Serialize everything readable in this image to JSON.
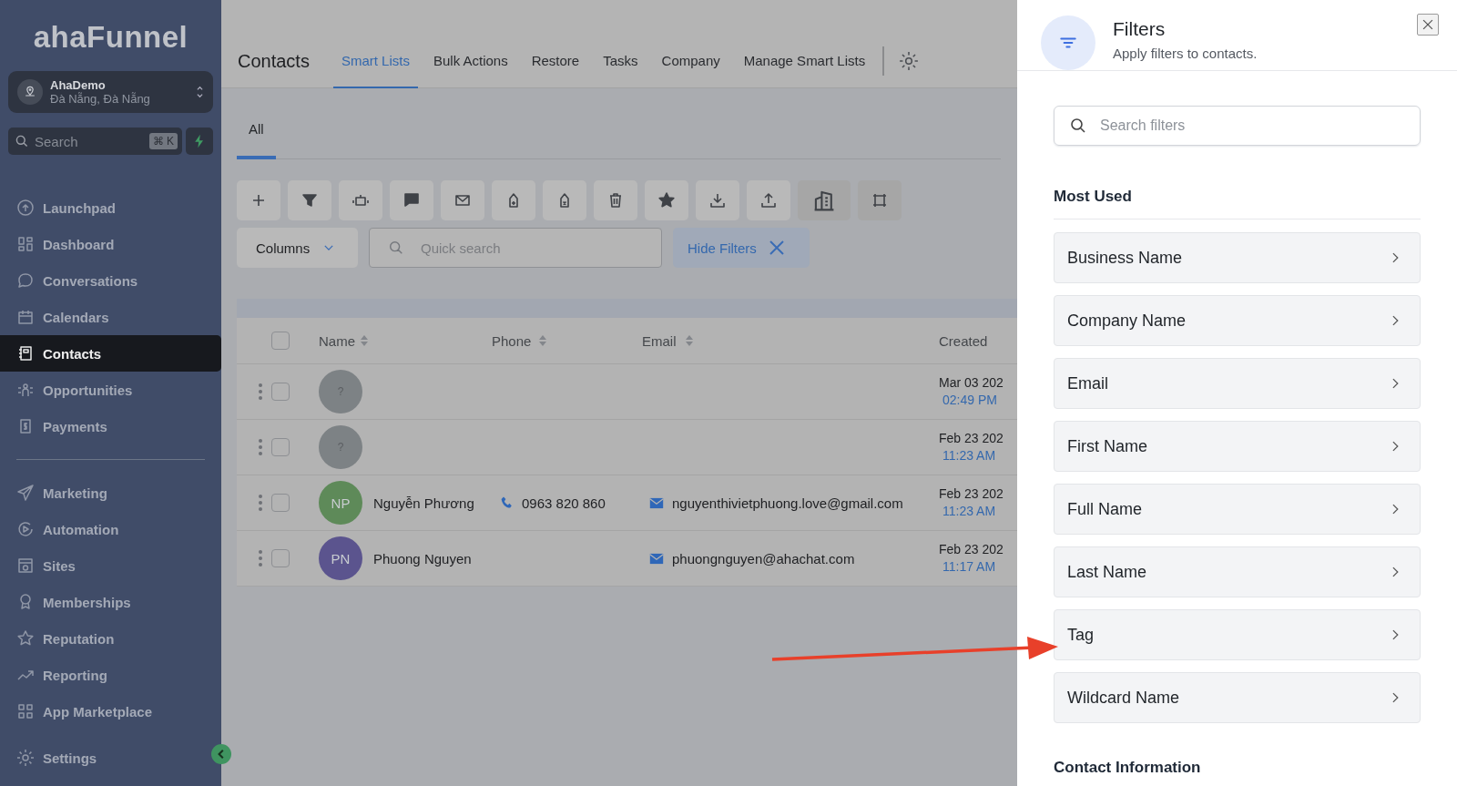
{
  "sidebar": {
    "logo": "ahaFunnel",
    "account": {
      "name": "AhaDemo",
      "location": "Đà Nẵng, Đà Nẵng"
    },
    "search": {
      "placeholder": "Search",
      "shortcut": "⌘ K"
    },
    "nav_groups": [
      [
        {
          "label": "Launchpad",
          "selected": false
        },
        {
          "label": "Dashboard",
          "selected": false
        },
        {
          "label": "Conversations",
          "selected": false
        },
        {
          "label": "Calendars",
          "selected": false
        },
        {
          "label": "Contacts",
          "selected": true
        },
        {
          "label": "Opportunities",
          "selected": false
        },
        {
          "label": "Payments",
          "selected": false
        }
      ],
      [
        {
          "label": "Marketing",
          "selected": false
        },
        {
          "label": "Automation",
          "selected": false
        },
        {
          "label": "Sites",
          "selected": false
        },
        {
          "label": "Memberships",
          "selected": false
        },
        {
          "label": "Reputation",
          "selected": false
        },
        {
          "label": "Reporting",
          "selected": false
        },
        {
          "label": "App Marketplace",
          "selected": false
        }
      ],
      [
        {
          "label": "Settings",
          "selected": false
        }
      ]
    ]
  },
  "header": {
    "title": "Contacts",
    "tabs": [
      {
        "label": "Smart Lists",
        "selected": true
      },
      {
        "label": "Bulk Actions",
        "selected": false
      },
      {
        "label": "Restore",
        "selected": false
      },
      {
        "label": "Tasks",
        "selected": false
      },
      {
        "label": "Company",
        "selected": false
      },
      {
        "label": "Manage Smart Lists",
        "selected": false
      }
    ]
  },
  "list_tabs": [
    {
      "label": "All",
      "selected": true
    }
  ],
  "controls": {
    "columns": "Columns",
    "quick_search": {
      "placeholder": "Quick search"
    },
    "hide_filters": "Hide Filters"
  },
  "table": {
    "all_checked": false,
    "columns": [
      "Name",
      "Phone",
      "Email",
      "Created"
    ],
    "rows": [
      {
        "avatar": "?",
        "color": "#7d8285",
        "name": "",
        "phone": "",
        "email": "",
        "date": "Mar 03 202",
        "time": "02:49 PM",
        "checked": false
      },
      {
        "avatar": "?",
        "color": "#7d8285",
        "name": "",
        "phone": "",
        "email": "",
        "date": "Feb 23 202",
        "time": "11:23 AM",
        "checked": false
      },
      {
        "avatar": "NP",
        "color": "#5e8a59",
        "name": "Nguyễn Phương",
        "phone": "0963 820 860",
        "email": "nguyenthivietphuong.love@gmail.com",
        "date": "Feb 23 202",
        "time": "11:23 AM",
        "checked": false
      },
      {
        "avatar": "PN",
        "color": "#5b548e",
        "name": "Phuong Nguyen",
        "phone": "",
        "email": "phuongnguyen@ahachat.com",
        "date": "Feb 23 202",
        "time": "11:17 AM",
        "checked": false
      }
    ]
  },
  "filters_panel": {
    "title": "Filters",
    "subtitle": "Apply filters to contacts.",
    "search": {
      "placeholder": "Search filters"
    },
    "sections": [
      {
        "title": "Most Used",
        "items": [
          "Business Name",
          "Company Name",
          "Email",
          "First Name",
          "Full Name",
          "Last Name",
          "Tag",
          "Wildcard Name"
        ]
      },
      {
        "title": "Contact Information"
      }
    ]
  }
}
